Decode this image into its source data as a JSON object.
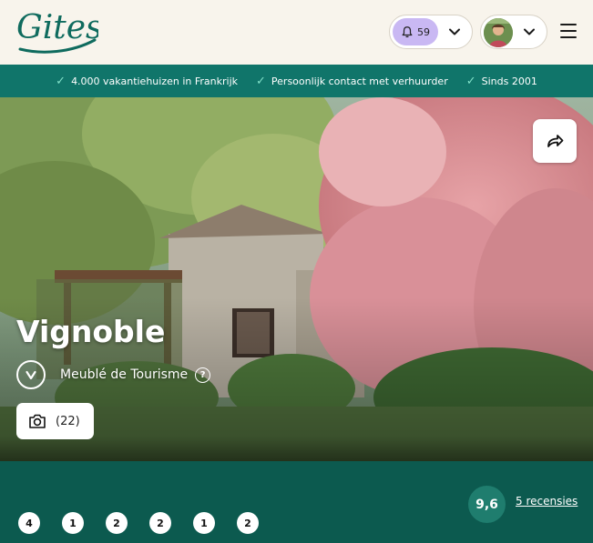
{
  "header": {
    "logo_text": "Gites",
    "notifications": {
      "count": "59",
      "icon": "bell-icon"
    },
    "account": {
      "icon": "avatar"
    },
    "menu_icon": "hamburger-icon"
  },
  "usp_bar": {
    "items": [
      {
        "label": "4.000 vakantiehuizen in Frankrijk"
      },
      {
        "label": "Persoonlijk contact met verhuurder"
      },
      {
        "label": "Sinds 2001"
      }
    ]
  },
  "hero": {
    "title": "Vignoble",
    "label": "Meublé de Tourisme",
    "help_mark": "?",
    "photos_count": "(22)",
    "share_icon": "share-arrow-icon"
  },
  "rating": {
    "score": "9,6",
    "reviews_link": "5 recensies"
  },
  "facts": [
    "4",
    "1",
    "2",
    "2",
    "1",
    "2"
  ],
  "colors": {
    "header_bg": "#f8f4ec",
    "usp_bg": "#10756a",
    "panel_bg": "#0c5a4f",
    "score_bg": "#1f7d6e",
    "logo": "#0f6b5e",
    "notif_pill": "#c9b8f3"
  }
}
